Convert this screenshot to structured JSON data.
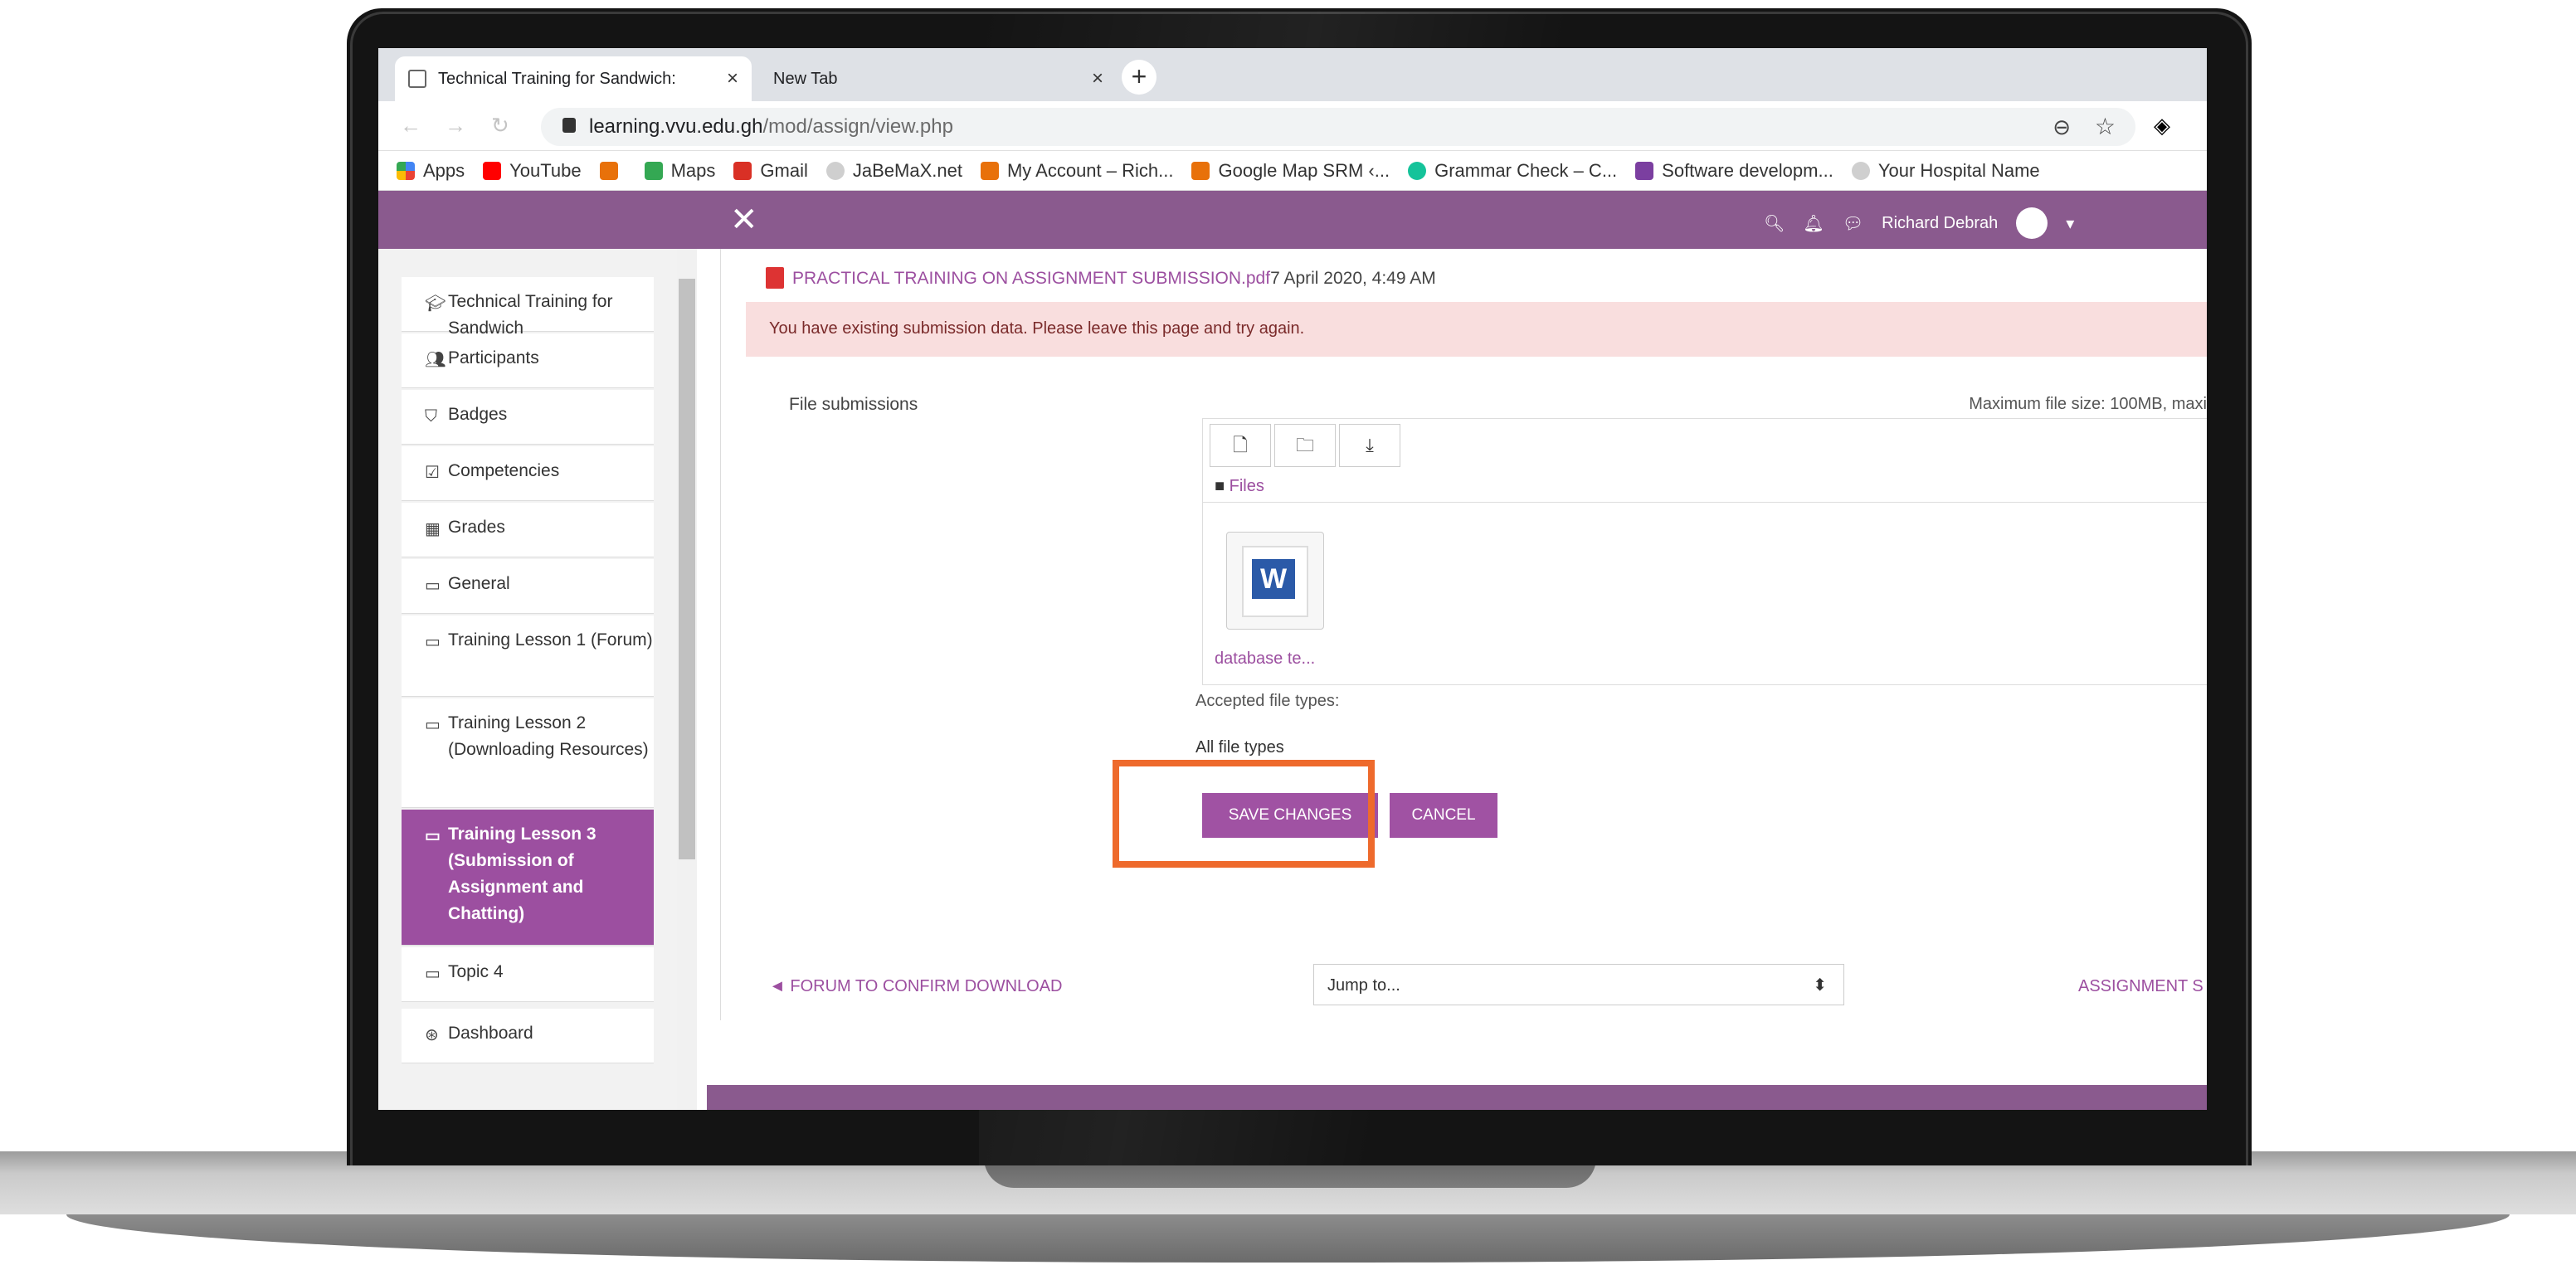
{
  "browser": {
    "tabs": [
      {
        "label": "Technical Training for Sandwich:",
        "close": "×"
      },
      {
        "label": "New Tab",
        "close": "×"
      }
    ],
    "new_tab": "+",
    "url_host": "learning.vvu.edu.gh",
    "url_path": "/mod/assign/view.php",
    "bookmarks": [
      {
        "label": "Apps",
        "icon": "apps-icon",
        "color": "#e8453c"
      },
      {
        "label": "YouTube",
        "icon": "youtube-icon",
        "color": "#ff0000"
      },
      {
        "label": "",
        "icon": "bookmark-icon",
        "color": "#e8710a"
      },
      {
        "label": "Maps",
        "icon": "maps-icon",
        "color": "#34a853"
      },
      {
        "label": "Gmail",
        "icon": "gmail-icon",
        "color": "#d93025"
      },
      {
        "label": "JaBeMaX.net",
        "icon": "globe-icon",
        "color": "#cfcfcf"
      },
      {
        "label": "My Account – Rich...",
        "icon": "bookmark-icon",
        "color": "#e8710a"
      },
      {
        "label": "Google Map SRM ‹...",
        "icon": "bookmark-icon",
        "color": "#e8710a"
      },
      {
        "label": "Grammar Check – C...",
        "icon": "grammarly-icon",
        "color": "#15c39a"
      },
      {
        "label": "Software developm...",
        "icon": "bolt-icon",
        "color": "#7b3fa0"
      },
      {
        "label": "Your Hospital Name",
        "icon": "globe-icon",
        "color": "#cfcfcf"
      }
    ]
  },
  "header": {
    "close": "✕",
    "user_name": "Richard Debrah"
  },
  "sidebar": {
    "items": [
      {
        "label": "Technical Training for Sandwich",
        "icon": "graduation-cap-icon",
        "glyph": "🎓"
      },
      {
        "label": "Participants",
        "icon": "users-icon",
        "glyph": "👥"
      },
      {
        "label": "Badges",
        "icon": "shield-icon",
        "glyph": "⛉"
      },
      {
        "label": "Competencies",
        "icon": "checkbox-icon",
        "glyph": "☑"
      },
      {
        "label": "Grades",
        "icon": "table-icon",
        "glyph": "▦"
      },
      {
        "label": "General",
        "icon": "folder-icon",
        "glyph": "🗀"
      },
      {
        "label": "Training Lesson 1 (Forum)",
        "icon": "folder-icon",
        "glyph": "🗀"
      },
      {
        "label": "Training Lesson 2 (Downloading Resources)",
        "icon": "folder-icon",
        "glyph": "🗀"
      },
      {
        "label": "Training Lesson 3 (Submission of Assignment and Chatting)",
        "icon": "folder-icon",
        "glyph": "🗀"
      },
      {
        "label": "Topic 4",
        "icon": "folder-icon",
        "glyph": "🗀"
      },
      {
        "label": "Dashboard",
        "icon": "dashboard-icon",
        "glyph": "⊛"
      }
    ]
  },
  "main": {
    "pdf_name": "PRACTICAL TRAINING ON ASSIGNMENT SUBMISSION.pdf",
    "pdf_date": "7 April 2020, 4:49 AM",
    "alert": "You have existing submission data. Please leave this page and try again.",
    "file_submissions_label": "File submissions",
    "max_size": "Maximum file size: 100MB, maxi",
    "files_label": "Files",
    "file_name": "database te...",
    "accepted_label": "Accepted file types:",
    "all_types": "All file types",
    "save_label": "SAVE CHANGES",
    "cancel_label": "CANCEL",
    "prev_link": "◄ FORUM TO CONFIRM DOWNLOAD",
    "jump_placeholder": "Jump to...",
    "next_link": "ASSIGNMENT S"
  }
}
